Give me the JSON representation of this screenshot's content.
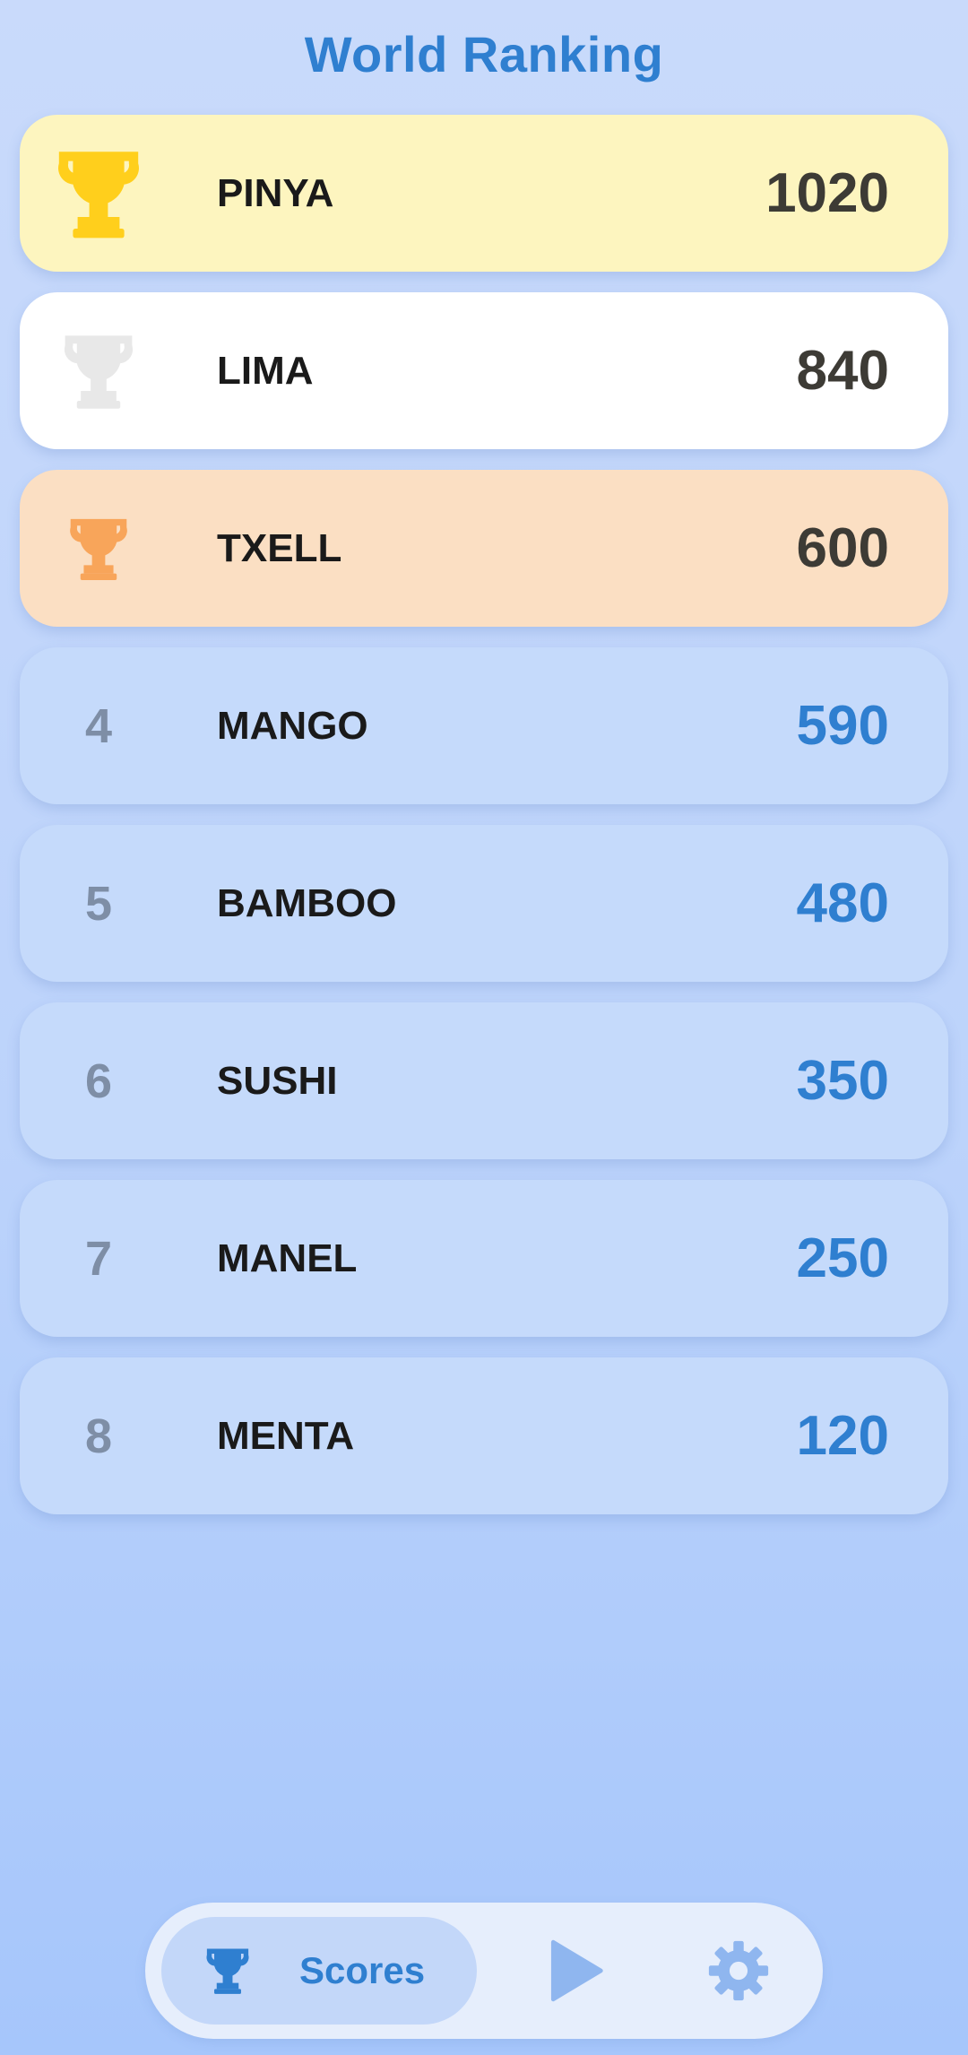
{
  "header": {
    "title": "World Ranking"
  },
  "ranking": [
    {
      "rank": "1",
      "name": "PINYA",
      "score": "1020",
      "trophy": "gold-trophy-icon",
      "color": "#ffcf1c"
    },
    {
      "rank": "2",
      "name": "LIMA",
      "score": "840",
      "trophy": "silver-trophy-icon",
      "color": "#ececec"
    },
    {
      "rank": "3",
      "name": "TXELL",
      "score": "600",
      "trophy": "bronze-trophy-icon",
      "color": "#f8a55a"
    },
    {
      "rank": "4",
      "name": "MANGO",
      "score": "590"
    },
    {
      "rank": "5",
      "name": "BAMBOO",
      "score": "480"
    },
    {
      "rank": "6",
      "name": "SUSHI",
      "score": "350"
    },
    {
      "rank": "7",
      "name": "MANEL",
      "score": "250"
    },
    {
      "rank": "8",
      "name": "MENTA",
      "score": "120"
    }
  ],
  "nav": {
    "scores_label": "Scores",
    "scores_icon": "trophy-icon",
    "play_icon": "play-icon",
    "settings_icon": "gear-icon"
  },
  "colors": {
    "accent": "#2f7fd0",
    "gold_row": "#fdf5bf",
    "silver_row": "#ffffff",
    "bronze_row": "#fbdfc3",
    "default_row": "#c5dafb",
    "nav_icon_inactive": "#8fb6ef"
  }
}
